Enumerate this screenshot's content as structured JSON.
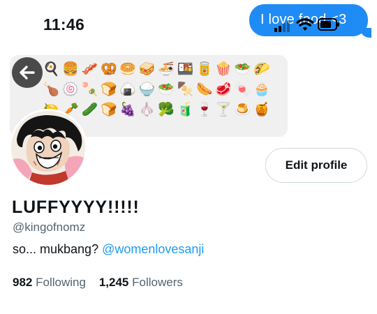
{
  "status_bar": {
    "time": "11:46",
    "icons": [
      "signal-icon",
      "wifi-icon",
      "battery-icon"
    ]
  },
  "message_bubble": {
    "text": "I love food <3",
    "color": "#1f8cf5"
  },
  "banner": {
    "emojis": [
      "🍳",
      "🍔",
      "🥓",
      "🥨",
      "🥯",
      "🥪",
      "🍜",
      "🍱",
      "🥫",
      "🍿",
      "🥗",
      "🌮",
      "🍗",
      "🍥",
      "🍡",
      "🍞",
      "🍙",
      "🍚",
      "🥗",
      "🍢",
      "🌭",
      "🥩",
      "🍬",
      "🧁",
      "🍋",
      "🥕",
      "🥒",
      "🍞",
      "🍇",
      "🧄",
      "🥦",
      "🧃",
      "🍷",
      "🍸",
      "🍮",
      "🍯"
    ],
    "background": "#f0f0f0"
  },
  "profile": {
    "display_name": "LUFFYYYY!!!!!",
    "handle": "@kingofnomz",
    "bio_text": "so... mukbang? ",
    "bio_mention": "@womenlovesanji",
    "following_count": "982",
    "following_label": "Following",
    "followers_count": "1,245",
    "followers_label": "Followers",
    "edit_button_label": "Edit profile"
  },
  "colors": {
    "link": "#1d9bf0",
    "secondary_text": "#536471",
    "primary_text": "#0f1419"
  }
}
